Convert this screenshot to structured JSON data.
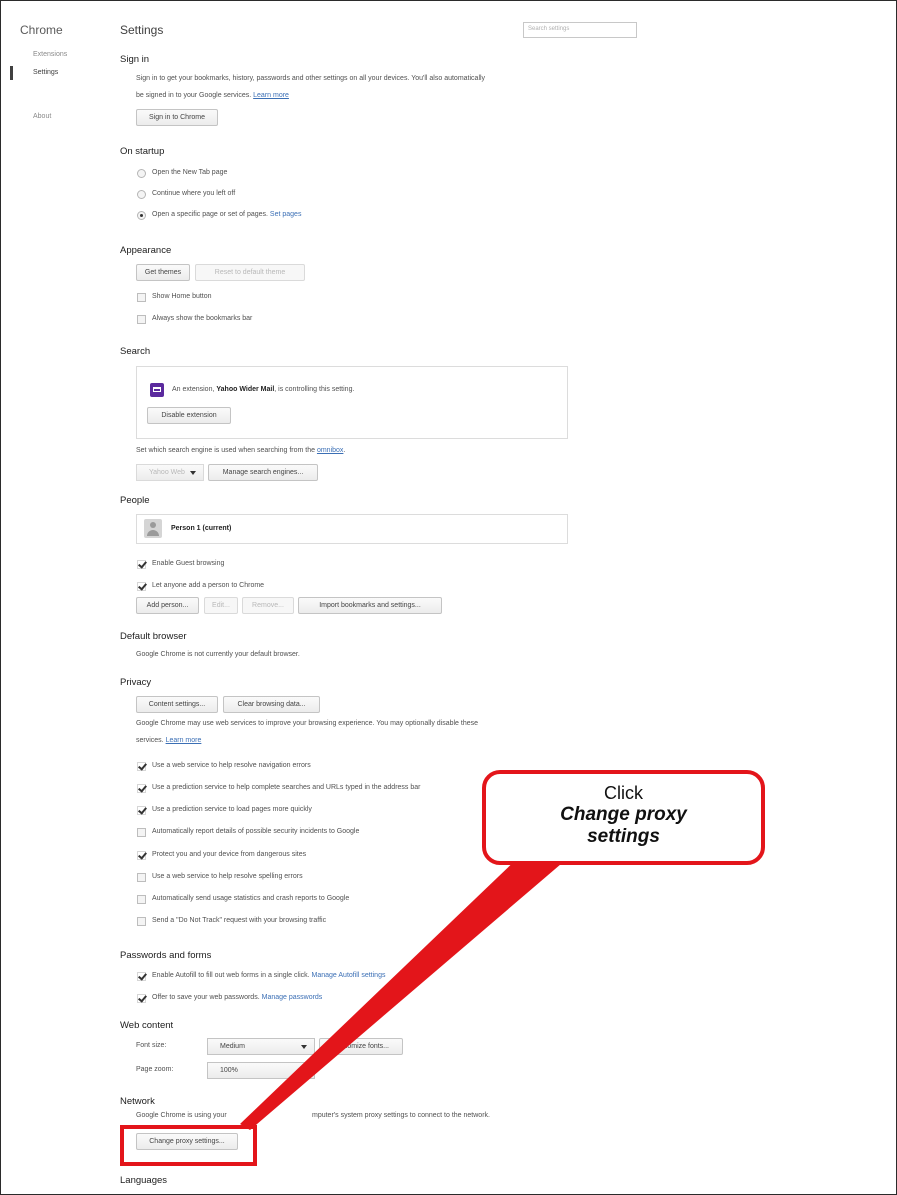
{
  "sidebar": {
    "title": "Chrome",
    "items": [
      {
        "label": "Extensions"
      },
      {
        "label": "Settings"
      },
      {
        "label": "About"
      }
    ]
  },
  "header": {
    "title": "Settings",
    "search_placeholder": "Search settings"
  },
  "sign_in": {
    "heading": "Sign in",
    "text_line1": "Sign in to get your bookmarks, history, passwords and other settings on all your devices. You'll also automatically",
    "text_line2": "be signed in to your Google services.",
    "learn_more": "Learn more",
    "button": "Sign in to Chrome"
  },
  "on_startup": {
    "heading": "On startup",
    "options": [
      {
        "label": "Open the New Tab page"
      },
      {
        "label": "Continue where you left off"
      },
      {
        "label": "Open a specific page or set of pages."
      }
    ],
    "set_pages": "Set pages",
    "selected_index": 2
  },
  "appearance": {
    "heading": "Appearance",
    "get_themes": "Get themes",
    "reset_theme": "Reset to default theme",
    "checkboxes": [
      {
        "label": "Show Home button",
        "checked": false
      },
      {
        "label": "Always show the bookmarks bar",
        "checked": false
      }
    ]
  },
  "search": {
    "heading": "Search",
    "ext_prefix": "An extension,",
    "ext_name": "Yahoo Wider Mail",
    "ext_suffix": ", is controlling this setting.",
    "disable_button": "Disable extension",
    "engine_text": "Set which search engine is used when searching from the",
    "omnibox": "omnibox",
    "engine_period": ".",
    "engine_select": "Yahoo Web",
    "manage_button": "Manage search engines..."
  },
  "people": {
    "heading": "People",
    "person": "Person 1 (current)",
    "checkboxes": [
      {
        "label": "Enable Guest browsing",
        "checked": true
      },
      {
        "label": "Let anyone add a person to Chrome",
        "checked": true
      }
    ],
    "buttons": {
      "add": "Add person...",
      "edit": "Edit...",
      "remove": "Remove...",
      "import": "Import bookmarks and settings..."
    }
  },
  "default_browser": {
    "heading": "Default browser",
    "text": "Google Chrome is not currently your default browser."
  },
  "privacy": {
    "heading": "Privacy",
    "content_settings": "Content settings...",
    "clear_data": "Clear browsing data...",
    "text_line1": "Google Chrome may use web services to improve your browsing experience. You may optionally disable these",
    "text_line2": "services.",
    "learn_more": "Learn more",
    "checkboxes": [
      {
        "label": "Use a web service to help resolve navigation errors",
        "checked": true
      },
      {
        "label": "Use a prediction service to help complete searches and URLs typed in the address bar",
        "checked": true
      },
      {
        "label": "Use a prediction service to load pages more quickly",
        "checked": true
      },
      {
        "label": "Automatically report details of possible security incidents to Google",
        "checked": false
      },
      {
        "label": "Protect you and your device from dangerous sites",
        "checked": true
      },
      {
        "label": "Use a web service to help resolve spelling errors",
        "checked": false
      },
      {
        "label": "Automatically send usage statistics and crash reports to Google",
        "checked": false
      },
      {
        "label": "Send a \"Do Not Track\" request with your browsing traffic",
        "checked": false
      }
    ]
  },
  "passwords": {
    "heading": "Passwords and forms",
    "autofill_text": "Enable Autofill to fill out web forms in a single click.",
    "autofill_link": "Manage Autofill settings",
    "save_text": "Offer to save your web passwords.",
    "save_link": "Manage passwords"
  },
  "web_content": {
    "heading": "Web content",
    "font_size_label": "Font size:",
    "font_size_value": "Medium",
    "customize_fonts": "Customize fonts...",
    "page_zoom_label": "Page zoom:",
    "page_zoom_value": "100%"
  },
  "network": {
    "heading": "Network",
    "text_left": "Google Chrome is using your",
    "text_right": "mputer's system proxy settings to connect to the network.",
    "button": "Change proxy settings..."
  },
  "languages": {
    "heading": "Languages"
  },
  "callout": {
    "line1": "Click",
    "line2": "Change proxy",
    "line3": "settings"
  },
  "colors": {
    "annotation_red": "#e3151a",
    "link_blue": "#3b6fb5",
    "extension_purple": "#5b2a9e"
  }
}
